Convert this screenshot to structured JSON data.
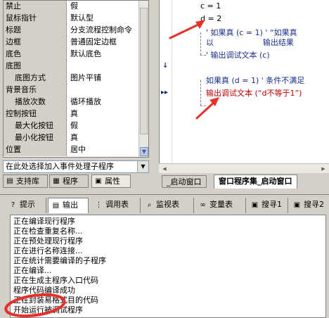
{
  "properties": [
    {
      "name": "禁止",
      "value": "假",
      "indent": false
    },
    {
      "name": "鼠标指针",
      "value": "默认型",
      "indent": false
    },
    {
      "name": "标题",
      "value": "分支流程控制命令",
      "indent": false
    },
    {
      "name": "边框",
      "value": "普通固定边框",
      "indent": false
    },
    {
      "name": "底色",
      "value": "默认底色",
      "indent": false
    },
    {
      "name": "底图",
      "value": "",
      "indent": false
    },
    {
      "name": "底图方式",
      "value": "图片平铺",
      "indent": true
    },
    {
      "name": "背景音乐",
      "value": "",
      "indent": false
    },
    {
      "name": "播放次数",
      "value": "循环播放",
      "indent": true
    },
    {
      "name": "控制按钮",
      "value": "真",
      "indent": false
    },
    {
      "name": "最大化按钮",
      "value": "假",
      "indent": true
    },
    {
      "name": "最小化按钮",
      "value": "真",
      "indent": true
    },
    {
      "name": "位置",
      "value": "居中",
      "indent": false
    }
  ],
  "event_combo": {
    "text": "在此处选择加入事件处理子程序"
  },
  "left_tabs": [
    {
      "label": "支持库",
      "icon": "library-icon"
    },
    {
      "label": "程序",
      "icon": "program-icon"
    },
    {
      "label": "属性",
      "icon": "properties-icon"
    }
  ],
  "code": {
    "line1": "c = 1",
    "line2": "d = 2",
    "line3": "' 如果真 (c = 1) ' “如果真",
    "line4": "以                    输出结果",
    "line5": "' 输出调试文本 (c)",
    "line6": "如果真 (d = 1) ' 条件不满足",
    "line7": "输出调试文本 (“d不等于1”)"
  },
  "editor_tabs": [
    {
      "label": "_启动窗口"
    },
    {
      "label": "窗口程序集_启动窗口"
    }
  ],
  "bottom_tabs": [
    {
      "label": "提示",
      "icon": "hint-icon"
    },
    {
      "label": "输出",
      "icon": "output-icon"
    },
    {
      "label": "调用表",
      "icon": "call-table-icon"
    },
    {
      "label": "监视表",
      "icon": "watch-icon"
    },
    {
      "label": "变量表",
      "icon": "variable-icon"
    },
    {
      "label": "搜寻1",
      "icon": "search1-icon"
    },
    {
      "label": "搜寻2",
      "icon": "search2-icon"
    }
  ],
  "output_lines": [
    "正在编译现行程序",
    "正在检查重复名称...",
    "正在预处理现行程序",
    "正在进行名称连接...",
    "正在统计需要编译的子程序",
    "正在编译...",
    "正在生成主程序入口代码",
    "程序代码编译成功",
    "正在封装易格式目的代码",
    "开始运行被调试程序"
  ],
  "colors": {
    "annotation_red": "#e8302a",
    "comment_blue": "#1a2f8c",
    "statement_red": "#c00000"
  }
}
